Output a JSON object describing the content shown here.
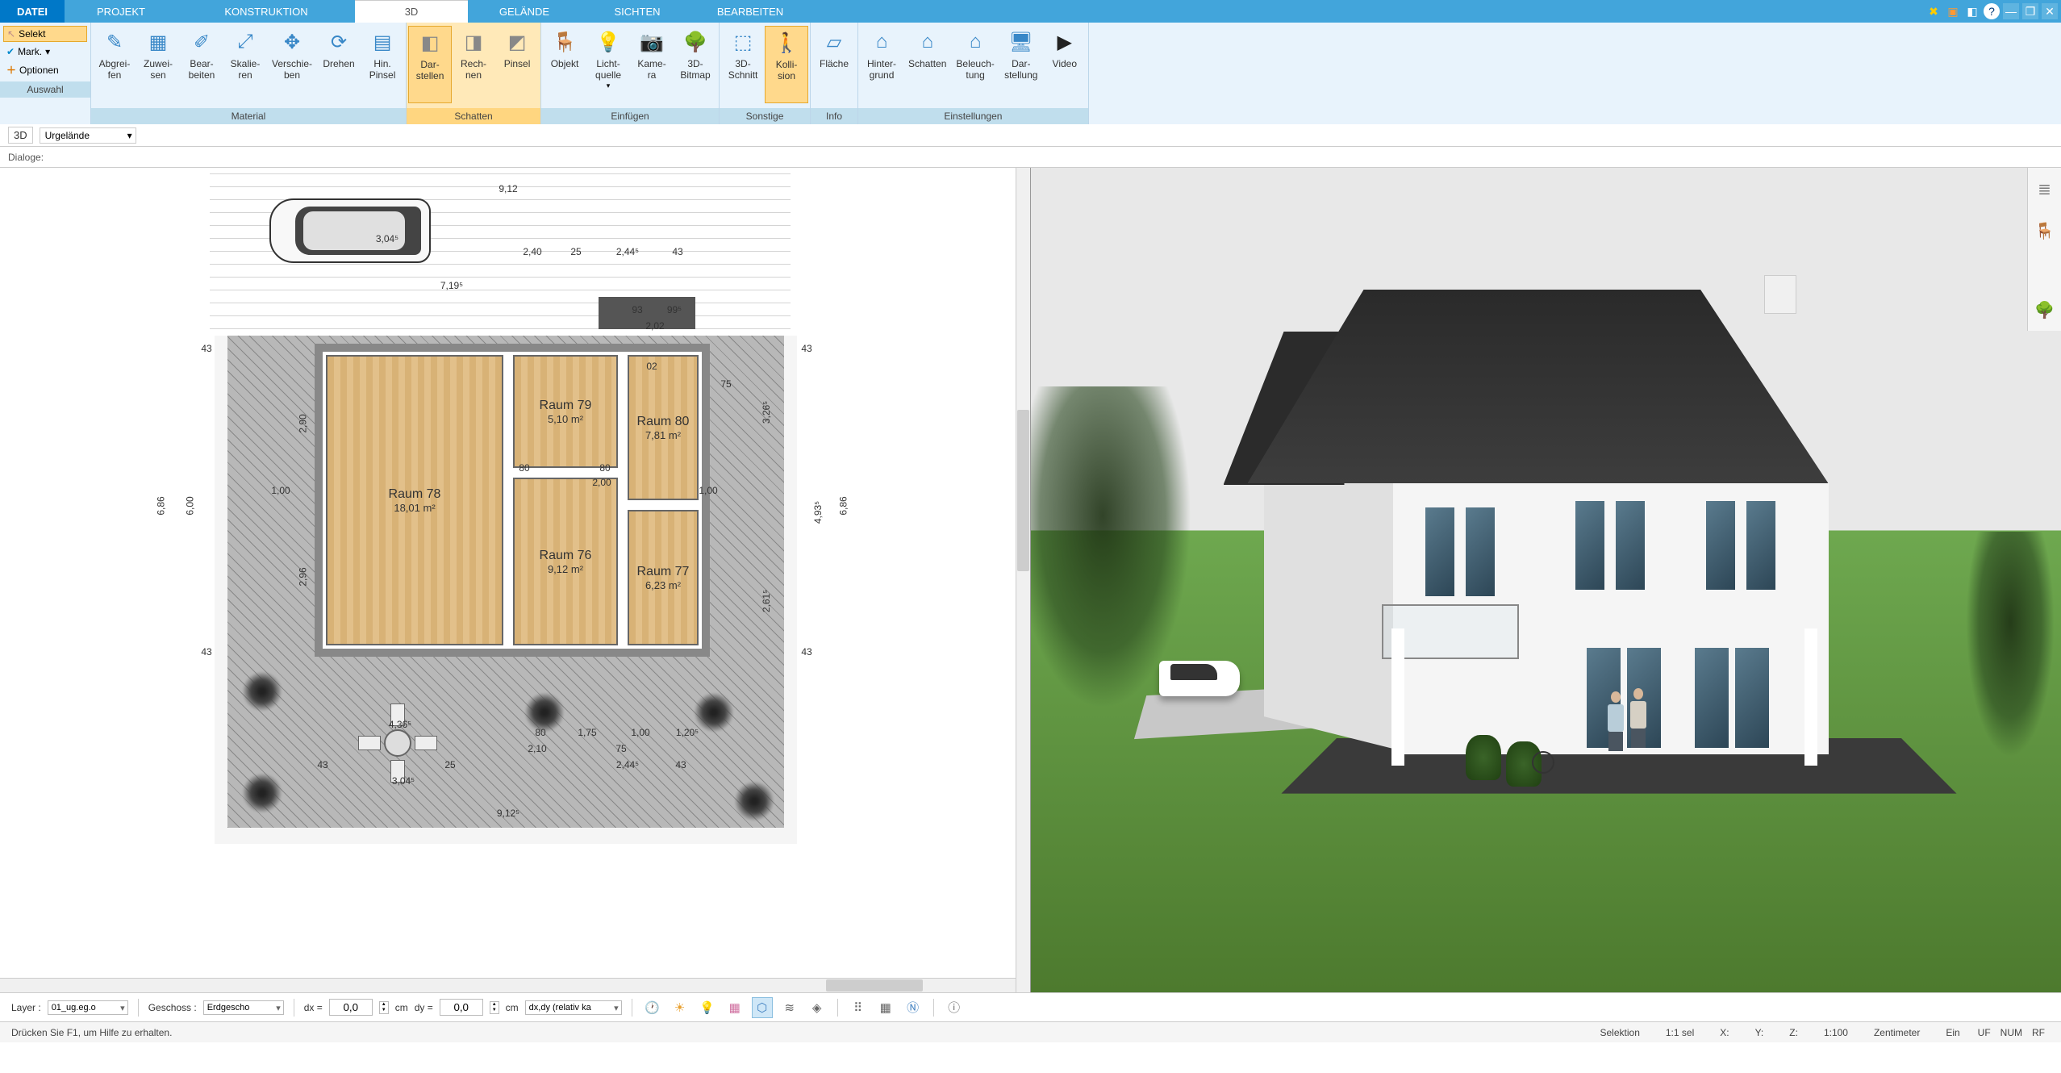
{
  "menu": {
    "datei": "DATEI",
    "projekt": "PROJEKT",
    "konstruktion": "KONSTRUKTION",
    "tab3d": "3D",
    "gelande": "GELÄNDE",
    "sichten": "SICHTEN",
    "bearbeiten": "BEARBEITEN"
  },
  "auswahl": {
    "selekt": "Selekt",
    "mark": "Mark.",
    "optionen": "Optionen",
    "group": "Auswahl"
  },
  "material": {
    "abgreifen": "Abgrei-\nfen",
    "zuweisen": "Zuwei-\nsen",
    "bearbeiten": "Bear-\nbeiten",
    "skalieren": "Skalie-\nren",
    "verschieben": "Verschie-\nben",
    "drehen": "Drehen",
    "hinpinsel": "Hin.\nPinsel",
    "group": "Material"
  },
  "schatten": {
    "darstellen": "Dar-\nstellen",
    "rechnen": "Rech-\nnen",
    "pinsel": "Pinsel",
    "group": "Schatten"
  },
  "einfuegen": {
    "objekt": "Objekt",
    "lichtquelle": "Licht-\nquelle",
    "kamera": "Kame-\nra",
    "bitmap": "3D-\nBitmap",
    "group": "Einfügen"
  },
  "sonstige": {
    "schnitt": "3D-\nSchnitt",
    "kollision": "Kolli-\nsion",
    "group": "Sonstige"
  },
  "info": {
    "flaeche": "Fläche",
    "group": "Info"
  },
  "einstellungen": {
    "hintergrund": "Hinter-\ngrund",
    "schatten": "Schatten",
    "beleuchtung": "Beleuch-\ntung",
    "darstellung": "Dar-\nstellung",
    "video": "Video",
    "group": "Einstellungen"
  },
  "subbar": {
    "label3d": "3D",
    "urgelaende": "Urgelände"
  },
  "dialog": {
    "label": "Dialoge:"
  },
  "rooms": {
    "r78": {
      "name": "Raum 78",
      "area": "18,01 m²"
    },
    "r79": {
      "name": "Raum 79",
      "area": "5,10 m²"
    },
    "r80": {
      "name": "Raum 80",
      "area": "7,81 m²"
    },
    "r76": {
      "name": "Raum 76",
      "area": "9,12 m²"
    },
    "r77": {
      "name": "Raum 77",
      "area": "6,23 m²"
    }
  },
  "dims": {
    "top_total": "9,12",
    "top_car": "3,04⁵",
    "d719": "7,19⁵",
    "d240": "2,40",
    "d25": "25",
    "d244": "2,44⁵",
    "d43": "43",
    "d93": "93",
    "d99": "99⁵",
    "d202": "2,02",
    "left600": "6,00",
    "left686": "6,86",
    "l290": "2,90",
    "l296": "2,96",
    "l100": "1,00",
    "r326": "3,26⁵",
    "r493": "4,93⁵",
    "r261": "2,61⁵",
    "r75": "75",
    "r686": "6,86",
    "b80": "80",
    "b175": "1,75",
    "b100": "1,00",
    "b120": "1,20⁵",
    "b210": "2,10",
    "b75": "75",
    "b244": "2,44⁵",
    "b912f": "9,12⁵",
    "b304": "3,04⁵",
    "b436": "4,36⁵",
    "c80": "80",
    "c200": "2,00",
    "c02": "02"
  },
  "bottom": {
    "layer": "Layer :",
    "layerval": "01_ug.eg.o",
    "geschoss": "Geschoss :",
    "geschossval": "Erdgescho",
    "dx": "dx =",
    "dy": "dy =",
    "cm": "cm",
    "val": "0,0",
    "mode": "dx,dy (relativ ka"
  },
  "status": {
    "help": "Drücken Sie F1, um Hilfe zu erhalten.",
    "sel": "Selektion",
    "ratio": "1:1 sel",
    "x": "X:",
    "y": "Y:",
    "z": "Z:",
    "scale": "1:100",
    "unit": "Zentimeter",
    "ein": "Ein",
    "uf": "UF",
    "num": "NUM",
    "rf": "RF"
  }
}
